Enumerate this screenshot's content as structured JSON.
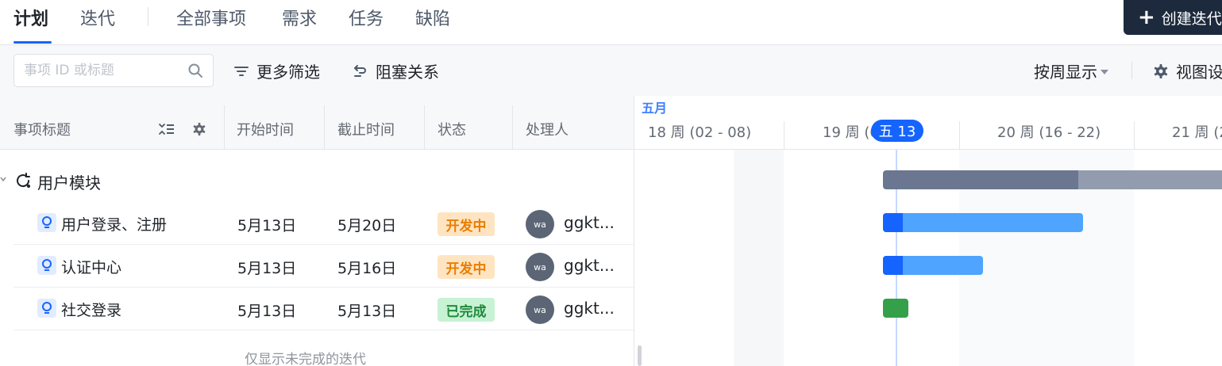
{
  "tabs": [
    {
      "label": "计划",
      "active": true
    },
    {
      "label": "迭代",
      "active": false
    },
    {
      "label": "全部事项",
      "active": false
    },
    {
      "label": "需求",
      "active": false
    },
    {
      "label": "任务",
      "active": false
    },
    {
      "label": "缺陷",
      "active": false
    }
  ],
  "create_button": {
    "icon": "plus-icon",
    "label": "创建迭代"
  },
  "toolbar": {
    "search_placeholder": "事项 ID 或标题",
    "more_filters": "更多筛选",
    "blocking": "阻塞关系",
    "view_by": "按周显示",
    "view_settings": "视图设置"
  },
  "columns": {
    "title": "事项标题",
    "start": "开始时间",
    "end": "截止时间",
    "status": "状态",
    "assignee": "处理人"
  },
  "group": {
    "label": "用户模块"
  },
  "items": [
    {
      "title": "用户登录、注册",
      "start": "5月13日",
      "end": "5月20日",
      "status": "开发中",
      "status_kind": "dev",
      "avatar": "wa",
      "assignee": "ggkt..."
    },
    {
      "title": "认证中心",
      "start": "5月13日",
      "end": "5月16日",
      "status": "开发中",
      "status_kind": "dev",
      "avatar": "wa",
      "assignee": "ggkt..."
    },
    {
      "title": "社交登录",
      "start": "5月13日",
      "end": "5月13日",
      "status": "已完成",
      "status_kind": "done",
      "avatar": "wa",
      "assignee": "ggkt..."
    }
  ],
  "footer_note": "仅显示未完成的迭代",
  "gantt": {
    "month": "五月",
    "weeks": [
      "18 周 (02 - 08)",
      "19 周 (0",
      "20 周 (16 - 22)",
      "21 周 (2"
    ],
    "today": "五 13"
  },
  "colors": {
    "accent": "#1664ff",
    "status_dev_bg": "#ffe4c2",
    "status_dev_fg": "#ea7d00",
    "status_done_bg": "#c8f2d4",
    "status_done_fg": "#1f8a3b",
    "group_bar": "#6b7790",
    "group_bar_light": "#939cae",
    "task_bar": "#4ea4ff",
    "task_bar_start": "#1664ff",
    "done_bar": "#34a04a"
  }
}
